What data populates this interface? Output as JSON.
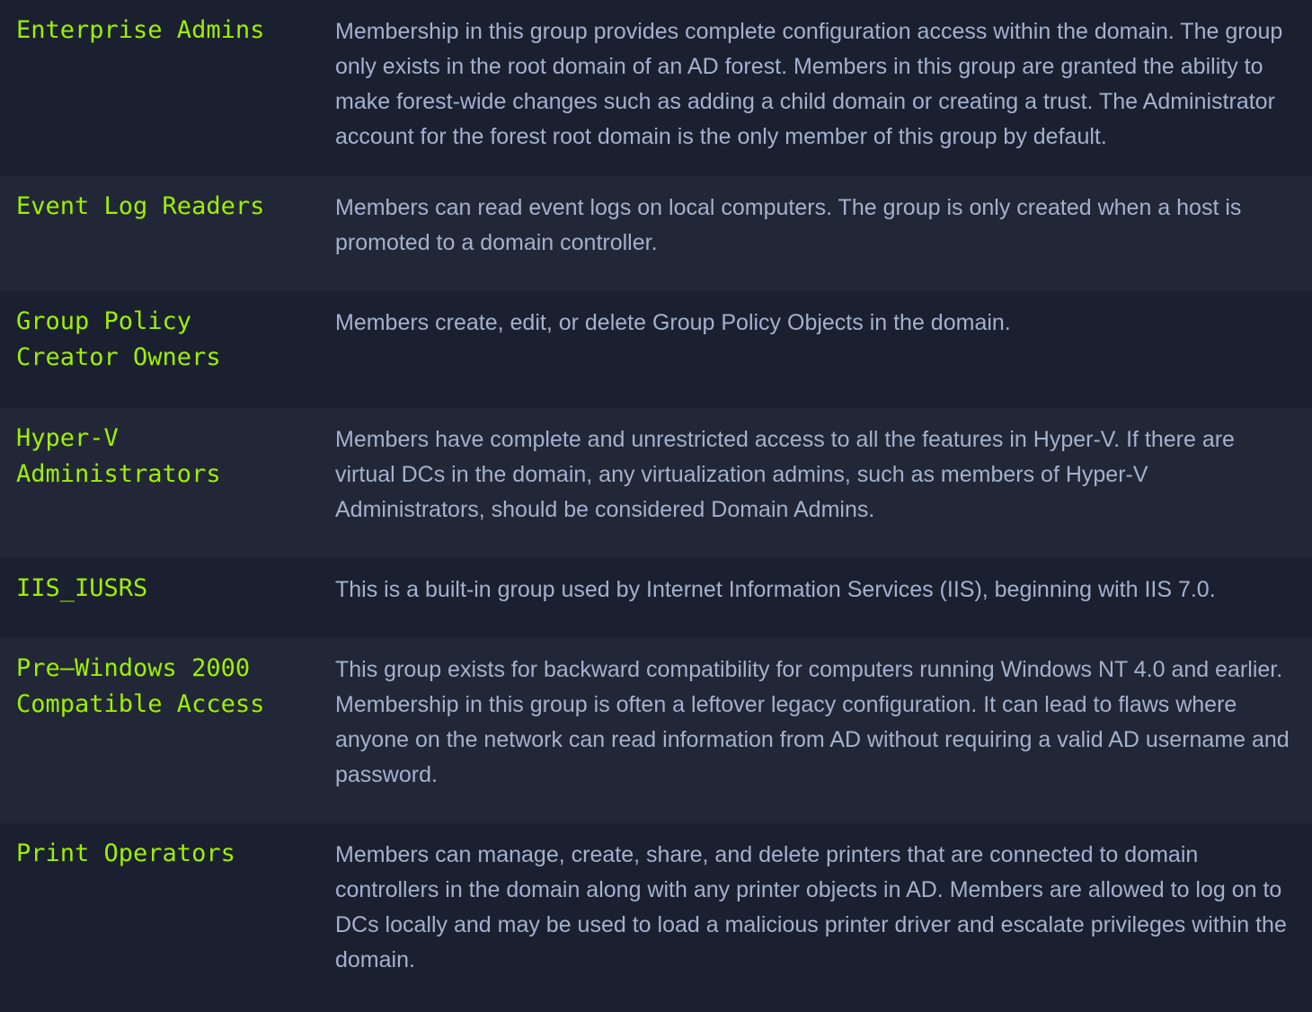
{
  "groups": [
    {
      "name": "Enterprise Admins",
      "description": "Membership in this group provides complete configuration access within the domain. The group only exists in the root domain of an AD forest. Members in this group are granted the ability to make forest-wide changes such as adding a child domain or creating a trust. The Administrator account for the forest root domain is the only member of this group by default."
    },
    {
      "name": "Event Log Readers",
      "description": "Members can read event logs on local computers. The group is only created when a host is promoted to a domain controller."
    },
    {
      "name": "Group Policy Creator Owners",
      "description": "Members create, edit, or delete Group Policy Objects in the domain."
    },
    {
      "name": "Hyper-V Administrators",
      "description": "Members have complete and unrestricted access to all the features in Hyper-V. If there are virtual DCs in the domain, any virtualization admins, such as members of Hyper-V Administrators, should be considered Domain Admins."
    },
    {
      "name": "IIS_IUSRS",
      "description": "This is a built-in group used by Internet Information Services (IIS), beginning with IIS 7.0."
    },
    {
      "name": "Pre–Windows 2000 Compatible Access",
      "description": "This group exists for backward compatibility for computers running Windows NT 4.0 and earlier. Membership in this group is often a leftover legacy configuration. It can lead to flaws where anyone on the network can read information from AD without requiring a valid AD username and password."
    },
    {
      "name": "Print Operators",
      "description": "Members can manage, create, share, and delete printers that are connected to domain controllers in the domain along with any printer objects in AD. Members are allowed to log on to DCs locally and may be used to load a malicious printer driver and escalate privileges within the domain."
    }
  ]
}
